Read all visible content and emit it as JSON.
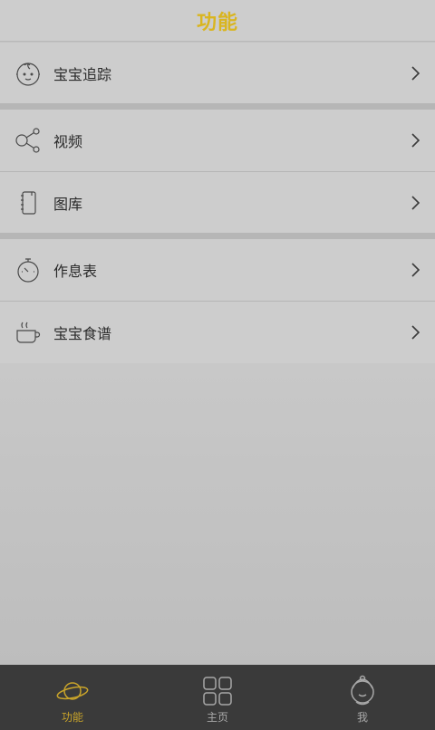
{
  "header": {
    "title": "功能"
  },
  "menu": {
    "baby_tracking": {
      "label": "宝宝追踪",
      "icon": "baby-face-icon"
    },
    "video": {
      "label": "视频",
      "icon": "share-icon"
    },
    "gallery": {
      "label": "图库",
      "icon": "photo-album-icon"
    },
    "schedule": {
      "label": "作息表",
      "icon": "stopwatch-icon"
    },
    "recipes": {
      "label": "宝宝食谱",
      "icon": "steaming-bowl-icon"
    }
  },
  "tabs": [
    {
      "label": "功能",
      "icon": "planet-icon",
      "active": true
    },
    {
      "label": "主页",
      "icon": "grid-icon",
      "active": false
    },
    {
      "label": "我",
      "icon": "user-icon",
      "active": false
    }
  ],
  "colors": {
    "accent": "#d9b520",
    "tab_active": "#c9a42a",
    "tab_inactive": "#a8a8a8",
    "tabbar_bg": "#3a3a3a",
    "row_bg": "#cdcdcd"
  }
}
